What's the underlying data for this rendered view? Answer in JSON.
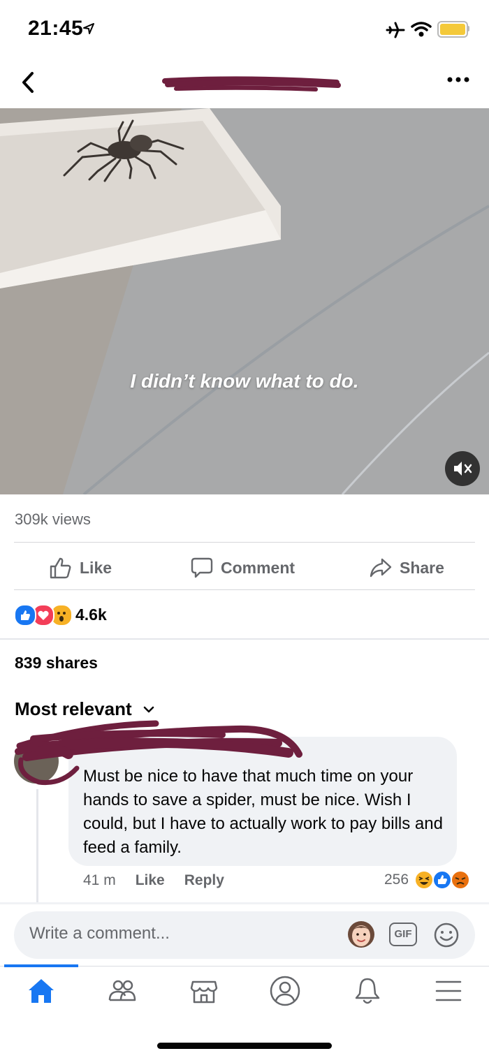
{
  "status_bar": {
    "time": "21:45",
    "battery_color": "#f4c93a"
  },
  "header": {
    "back_icon": "chevron-left-icon",
    "more_icon": "ellipsis-icon"
  },
  "video": {
    "caption": "I didn’t know what to do."
  },
  "post": {
    "views": "309k views",
    "actions": {
      "like": "Like",
      "comment": "Comment",
      "share": "Share"
    },
    "reaction_count": "4.6k",
    "shares": "839 shares",
    "sort_label": "Most relevant"
  },
  "comment": {
    "text": "Must be nice to have that much time on your hands to save a spider, must be nice. Wish I could, but I have to actually work to pay bills and feed a family.",
    "time": "41 m",
    "like": "Like",
    "reply": "Reply",
    "reaction_count": "256"
  },
  "composer": {
    "placeholder": "Write a comment...",
    "gif_label": "GIF"
  },
  "colors": {
    "accent": "#1877f2",
    "redaction": "#6e1f3e",
    "love": "#f33e58",
    "haha": "#f7b125",
    "angry": "#e9710f"
  }
}
